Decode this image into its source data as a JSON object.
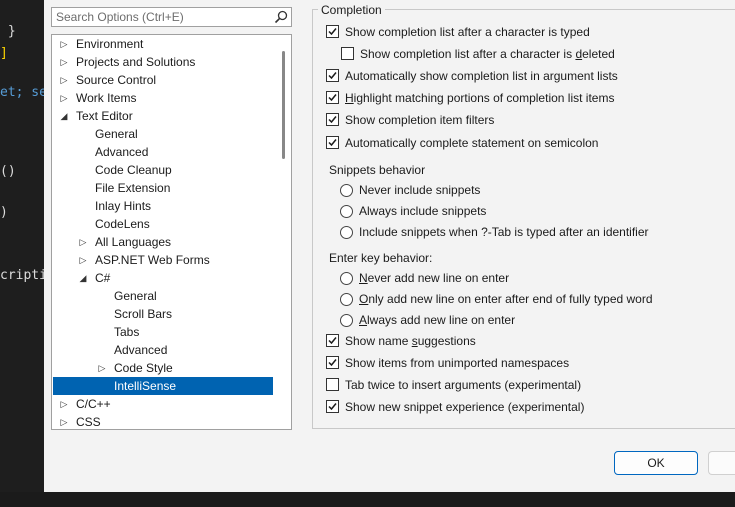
{
  "editor": {
    "lines": [
      {
        "text": " }",
        "color": "#dcdcdc"
      },
      {
        "text": "]",
        "color": "#ffd700"
      },
      {
        "text": "et; se",
        "color": "#569cd6"
      },
      {
        "text": "()",
        "color": "#dcdcdc"
      },
      {
        "text": ")",
        "color": "#dcdcdc"
      },
      {
        "text": "cripti",
        "color": "#dcdcdc"
      }
    ]
  },
  "search": {
    "placeholder": "Search Options (Ctrl+E)",
    "value": ""
  },
  "tree": {
    "items": [
      {
        "label": "Environment",
        "expander": "collapsed"
      },
      {
        "label": "Projects and Solutions",
        "expander": "collapsed"
      },
      {
        "label": "Source Control",
        "expander": "collapsed"
      },
      {
        "label": "Work Items",
        "expander": "collapsed"
      },
      {
        "label": "Text Editor",
        "expander": "expanded"
      },
      {
        "label": "General",
        "expander": "none"
      },
      {
        "label": "Advanced",
        "expander": "none"
      },
      {
        "label": "Code Cleanup",
        "expander": "none"
      },
      {
        "label": "File Extension",
        "expander": "none"
      },
      {
        "label": "Inlay Hints",
        "expander": "none"
      },
      {
        "label": "CodeLens",
        "expander": "none"
      },
      {
        "label": "All Languages",
        "expander": "collapsed"
      },
      {
        "label": "ASP.NET Web Forms",
        "expander": "collapsed"
      },
      {
        "label": "C#",
        "expander": "expanded"
      },
      {
        "label": "General",
        "expander": "none"
      },
      {
        "label": "Scroll Bars",
        "expander": "none"
      },
      {
        "label": "Tabs",
        "expander": "none"
      },
      {
        "label": "Advanced",
        "expander": "none"
      },
      {
        "label": "Code Style",
        "expander": "collapsed"
      },
      {
        "label": "IntelliSense",
        "expander": "none",
        "selected": true
      },
      {
        "label": "C/C++",
        "expander": "collapsed"
      },
      {
        "label": "CSS",
        "expander": "collapsed"
      }
    ]
  },
  "completion": {
    "title": "Completion",
    "show_after_typed": {
      "label": "Show completion list after a character is typed",
      "checked": true
    },
    "show_after_deleted": {
      "label_pre": "Show completion list after a character is ",
      "label_acc": "d",
      "label_post": "eleted",
      "checked": false
    },
    "auto_show_args": {
      "label": "Automatically show completion list in argument lists",
      "checked": true
    },
    "highlight": {
      "label_acc": "H",
      "label_post": "ighlight matching portions of completion list items",
      "checked": true
    },
    "item_filters": {
      "label": "Show completion item filters",
      "checked": true
    },
    "semicolon": {
      "label": "Automatically complete statement on semicolon",
      "checked": true
    }
  },
  "snippets": {
    "title": "Snippets behavior",
    "options": [
      {
        "label": "Never include snippets",
        "selected": false
      },
      {
        "label": "Always include snippets",
        "selected": false
      },
      {
        "label": "Include snippets when ?-Tab is typed after an identifier",
        "selected": false
      }
    ]
  },
  "enter_key": {
    "title": "Enter key behavior:",
    "options": [
      {
        "acc": "N",
        "rest": "ever add new line on enter",
        "selected": false
      },
      {
        "acc": "O",
        "rest": "nly add new line on enter after end of fully typed word",
        "selected": false
      },
      {
        "acc": "A",
        "rest": "lways add new line on enter",
        "selected": false
      }
    ]
  },
  "misc": {
    "name_suggestions": {
      "label_pre": "Show name ",
      "label_acc": "s",
      "label_post": "uggestions",
      "checked": true
    },
    "unimported": {
      "label": "Show items from unimported namespaces",
      "checked": true
    },
    "tab_twice": {
      "label": "Tab twice to insert arguments (experimental)",
      "checked": false
    },
    "new_snippet": {
      "label": "Show new snippet experience (experimental)",
      "checked": true
    }
  },
  "buttons": {
    "ok": "OK"
  },
  "colors": {
    "selection": "#0063b1",
    "accent": "#0067c0",
    "check": "#1b1b1b"
  }
}
